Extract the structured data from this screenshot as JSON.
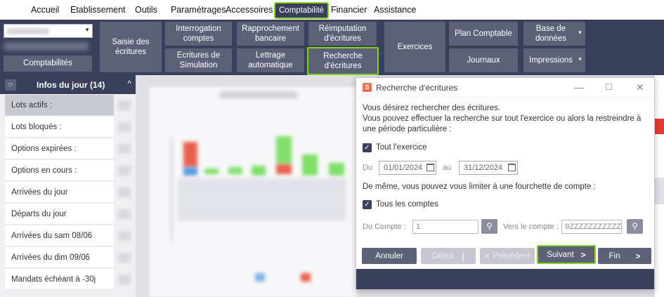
{
  "menu": {
    "items": [
      "Accueil",
      "Etablissement",
      "Outils",
      "Paramétrages",
      "Accessoires",
      "Comptabilité",
      "Financier",
      "Assistance"
    ]
  },
  "ribbon": {
    "comptabilites": "Comptabilités",
    "saisie": "Saisie des écritures",
    "interrogation": "Interrogation comptes",
    "ecritures_simulation": "Ecritures de Simulation",
    "rapprochement": "Rapprochement bancaire",
    "lettrage": "Lettrage automatique",
    "reimputation": "Réimputation d'écritures",
    "recherche": "Recherche d'écritures",
    "exercices": "Exercices",
    "plan_comptable": "Plan Comptable",
    "journaux": "Journaux",
    "base_donnees": "Base de données",
    "impressions": "Impressions"
  },
  "left_panel": {
    "title": "Infos du jour (14)",
    "items": [
      "Lots actifs :",
      "Lots bloqués :",
      "Options expirées :",
      "Options en cours :",
      "Arrivées du jour",
      "Départs du jour",
      "Arrivées du sam 08/06",
      "Arrivées du dim 09/06",
      "Mandats échéant à -30j"
    ]
  },
  "dialog": {
    "title": "Recherche d'écritures",
    "line1": "Vous désirez rechercher des écritures.",
    "line2": "Vous pouvez effectuer la recherche sur tout l'exercice ou alors la restreindre à",
    "line3": "une période particulière :",
    "tout_exercice": "Tout l'exercice",
    "du_label": "Du",
    "date_from": "01/01/2024",
    "au_label": "au",
    "date_to": "31/12/2024",
    "line4": "De même, vous pouvez vous limiter à une fourchette de compte :",
    "tous_comptes": "Tous les comptes",
    "du_compte_label": "Du Compte :",
    "du_compte_value": "1",
    "vers_compte_label": "Vers le compte :",
    "vers_compte_value": "9ZZZZZZZZZZZ",
    "btn_annuler": "Annuler",
    "btn_debut": "Début",
    "btn_precedent": "Précédent",
    "btn_suivant": "Suivant",
    "btn_fin": "Fin"
  },
  "colors": {
    "navy": "#3a3f5c",
    "button": "#5d6178",
    "highlight": "#7ed321",
    "accent": "#f26b4c"
  }
}
